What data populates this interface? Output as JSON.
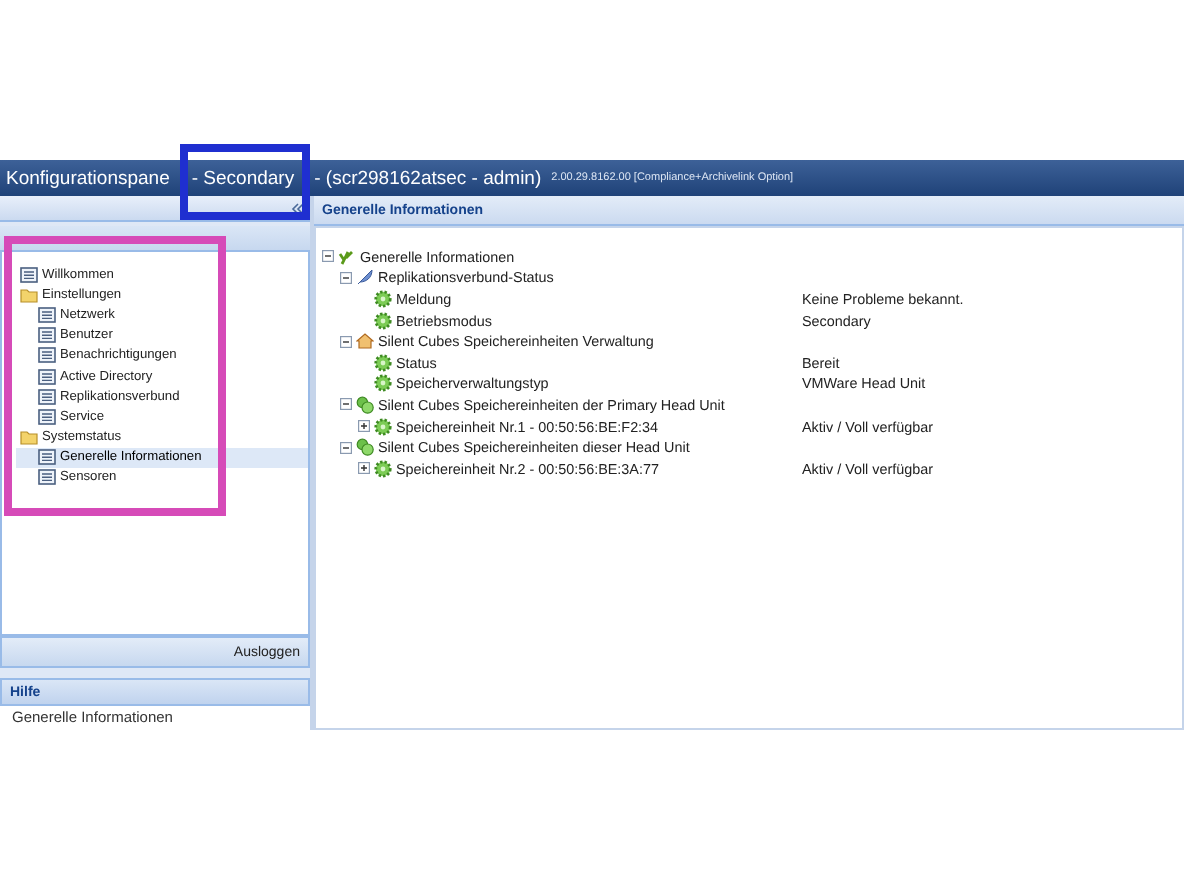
{
  "window": {
    "title": [
      "Konfigurationspane",
      "- Secondary",
      "- (scr298162atsec - admin)"
    ],
    "version": "2.00.29.8162.00 [Compliance+Archivelink Option]"
  },
  "sidebar": {
    "items": [
      {
        "label": "Willkommen",
        "kind": "page",
        "selected": false
      },
      {
        "label": "Einstellungen",
        "kind": "folder",
        "selected": false,
        "children": [
          {
            "label": "Netzwerk",
            "kind": "page",
            "selected": false
          },
          {
            "label": "Benutzer",
            "kind": "page",
            "selected": false
          },
          {
            "label": "Benachrichtigungen",
            "kind": "page",
            "selected": false
          },
          {
            "label": "Active Directory",
            "kind": "page",
            "selected": false
          },
          {
            "label": "Replikationsverbund",
            "kind": "page",
            "selected": false
          },
          {
            "label": "Service",
            "kind": "page",
            "selected": false
          }
        ]
      },
      {
        "label": "Systemstatus",
        "kind": "folder",
        "selected": false,
        "children": [
          {
            "label": "Generelle Informationen",
            "kind": "page",
            "selected": true
          },
          {
            "label": "Sensoren",
            "kind": "page",
            "selected": false
          }
        ]
      }
    ],
    "logout": "Ausloggen"
  },
  "help": {
    "title": "Hilfe",
    "text": "Generelle Informationen"
  },
  "content": {
    "title": "Generelle Informationen",
    "tree": [
      {
        "label": "Generelle Informationen",
        "kind": "plant",
        "children": [
          {
            "label": "Replikationsverbund-Status",
            "kind": "feather",
            "children": [
              {
                "label": "Meldung",
                "kind": "gear",
                "value": "Keine Probleme bekannt."
              },
              {
                "label": "Betriebsmodus",
                "kind": "gear",
                "value": "Secondary"
              }
            ]
          },
          {
            "label": "Silent Cubes Speichereinheiten Verwaltung",
            "kind": "house",
            "children": [
              {
                "label": "Status",
                "kind": "gear",
                "value": "Bereit"
              },
              {
                "label": "Speicherverwaltungstyp",
                "kind": "gear",
                "value": "VMWare Head Unit"
              }
            ]
          },
          {
            "label": "Silent Cubes Speichereinheiten der Primary Head Unit",
            "kind": "gears",
            "children": [
              {
                "label": "Speichereinheit Nr.1 - 00:50:56:BE:F2:34",
                "kind": "gear",
                "collapsed": true,
                "value": "Aktiv / Voll verfügbar"
              }
            ]
          },
          {
            "label": "Silent Cubes Speichereinheiten dieser Head Unit",
            "kind": "gears",
            "children": [
              {
                "label": "Speichereinheit Nr.2 - 00:50:56:BE:3A:77",
                "kind": "gear",
                "collapsed": true,
                "value": "Aktiv / Voll verfügbar"
              }
            ]
          }
        ]
      }
    ]
  },
  "annotations": [
    {
      "color": "#1f2fd0"
    },
    {
      "color": "#d64bb8"
    }
  ]
}
